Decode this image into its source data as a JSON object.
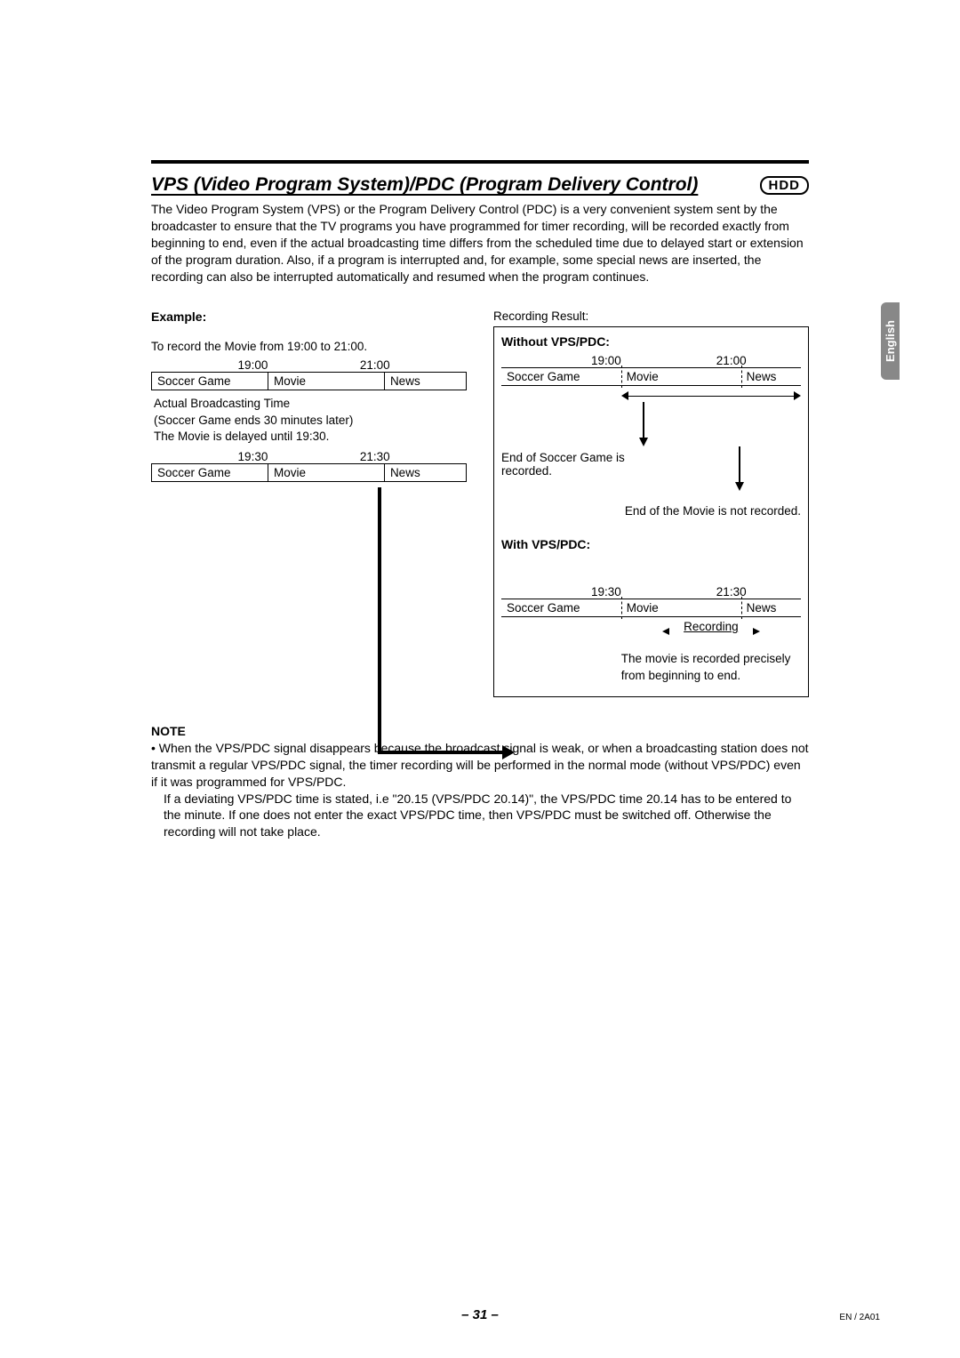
{
  "header": {
    "title": "VPS (Video Program System)/PDC (Program Delivery Control)",
    "badge": "HDD"
  },
  "intro": "The Video Program System (VPS) or the Program Delivery Control (PDC) is a very convenient system sent by the broadcaster to ensure that the TV programs you have programmed for timer recording, will be recorded exactly from beginning to end, even if the actual broadcasting time differs from the scheduled time due to delayed start or extension of the program duration. Also, if a program is interrupted and, for example, some special news are inserted, the recording can also be interrupted automatically and resumed when the program continues.",
  "language_tab": "English",
  "example": {
    "label": "Example:",
    "record_line": "To record the Movie from 19:00 to 21:00.",
    "times1": [
      "19:00",
      "21:00"
    ],
    "row1": [
      "Soccer Game",
      "Movie",
      "News"
    ],
    "actual_lines": [
      "Actual Broadcasting Time",
      "(Soccer Game ends 30 minutes later)",
      "The Movie is delayed until 19:30."
    ],
    "times2": [
      "19:30",
      "21:30"
    ],
    "row2": [
      "Soccer Game",
      "Movie",
      "News"
    ]
  },
  "result": {
    "label": "Recording Result:",
    "without": {
      "heading": "Without VPS/PDC:",
      "times": [
        "19:00",
        "21:00"
      ],
      "row": [
        "Soccer Game",
        "Movie",
        "News"
      ],
      "end_soccer": "End of Soccer Game is recorded.",
      "end_movie": "End of the Movie is not recorded."
    },
    "with": {
      "heading": "With VPS/PDC:",
      "times": [
        "19:30",
        "21:30"
      ],
      "row": [
        "Soccer Game",
        "Movie",
        "News"
      ],
      "recording": "Recording",
      "precise": "The movie is recorded precisely from beginning to end."
    }
  },
  "note": {
    "heading": "NOTE",
    "item1": "When the VPS/PDC signal disappears because the broadcast signal is weak, or when a broadcasting station does not transmit a regular VPS/PDC signal, the timer recording will be performed in the normal mode (without VPS/PDC) even if it was programmed for VPS/PDC.",
    "item2": "If a deviating VPS/PDC time is stated, i.e \"20.15 (VPS/PDC 20.14)\", the VPS/PDC time  20.14 has to be entered to the minute. If one does not enter the exact VPS/PDC time, then VPS/PDC must be switched off. Otherwise the recording will not take place."
  },
  "footer": {
    "page": "– 31 –",
    "code": "EN / 2A01"
  }
}
